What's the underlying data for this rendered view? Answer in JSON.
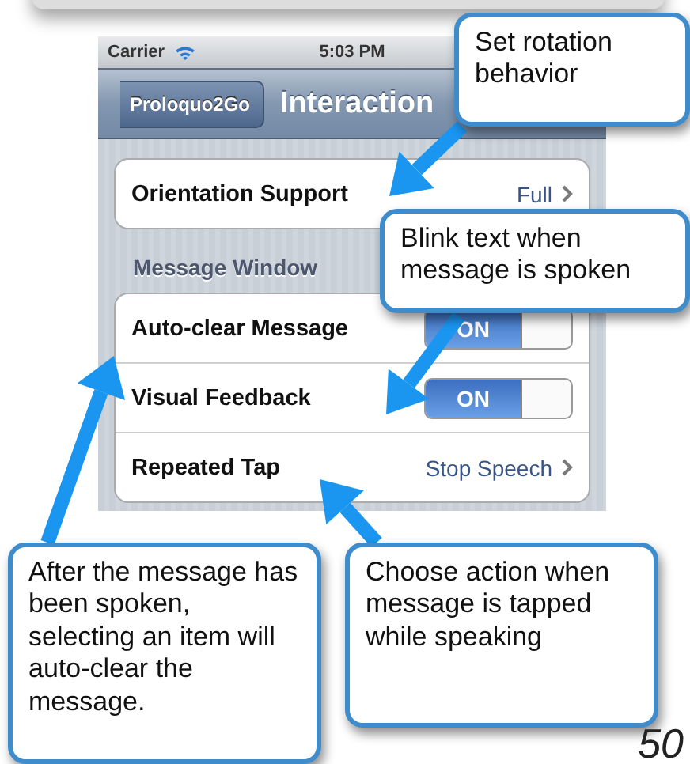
{
  "status_bar": {
    "carrier": "Carrier",
    "time": "5:03 PM"
  },
  "nav_bar": {
    "back_button": "Proloquo2Go",
    "title": "Interaction"
  },
  "groups": [
    {
      "rows": [
        {
          "kind": "value",
          "label": "Orientation Support",
          "value": "Full"
        }
      ]
    },
    {
      "header": "Message Window",
      "rows": [
        {
          "kind": "switch",
          "label": "Auto-clear Message",
          "on": true,
          "switch_text": "ON"
        },
        {
          "kind": "switch",
          "label": "Visual Feedback",
          "on": true,
          "switch_text": "ON"
        },
        {
          "kind": "value",
          "label": "Repeated Tap",
          "value": "Stop Speech"
        }
      ]
    }
  ],
  "callouts": [
    "Set rotation behavior",
    "Blink text when message is spoken",
    "After the message has been spoken, selecting an item will auto-clear the message.",
    "Choose action when message is tapped while speaking"
  ],
  "page_number": "50"
}
